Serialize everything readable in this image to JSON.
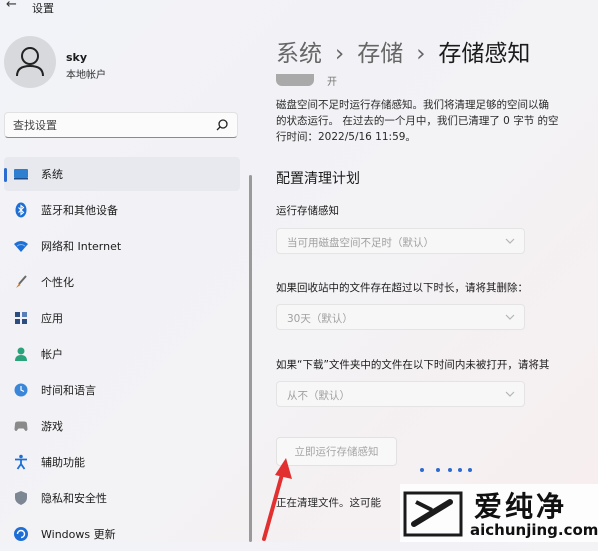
{
  "window": {
    "title": "设置",
    "back_icon": "back-arrow-icon"
  },
  "user": {
    "name": "sky",
    "account_type": "本地帐户"
  },
  "search": {
    "placeholder": "查找设置",
    "icon": "search-icon"
  },
  "sidebar": {
    "items": [
      {
        "label": "系统",
        "icon": "monitor-icon",
        "active": true
      },
      {
        "label": "蓝牙和其他设备",
        "icon": "bluetooth-icon",
        "active": false
      },
      {
        "label": "网络和 Internet",
        "icon": "wifi-icon",
        "active": false
      },
      {
        "label": "个性化",
        "icon": "brush-icon",
        "active": false
      },
      {
        "label": "应用",
        "icon": "apps-icon",
        "active": false
      },
      {
        "label": "帐户",
        "icon": "person-icon",
        "active": false
      },
      {
        "label": "时间和语言",
        "icon": "globe-clock-icon",
        "active": false
      },
      {
        "label": "游戏",
        "icon": "gamepad-icon",
        "active": false
      },
      {
        "label": "辅助功能",
        "icon": "accessibility-icon",
        "active": false
      },
      {
        "label": "隐私和安全性",
        "icon": "shield-icon",
        "active": false
      },
      {
        "label": "Windows 更新",
        "icon": "update-icon",
        "active": false
      }
    ]
  },
  "breadcrumb": {
    "items": [
      "系统",
      "存储"
    ],
    "current": "存储感知",
    "separator": "›"
  },
  "toggle": {
    "label": "开"
  },
  "description": {
    "lines": [
      "磁盘空间不足时运行存储感知。我们将清理足够的空间以确",
      "的状态运行。 在过去的一个月中，我们已清理了 0 字节 的空",
      "行时间：2022/5/16 11:59。"
    ]
  },
  "cleanup_plan": {
    "title": "配置清理计划",
    "fields": [
      {
        "label": "运行存储感知",
        "value": "当可用磁盘空间不足时（默认）"
      },
      {
        "label": "如果回收站中的文件存在超过以下时长，请将其删除：",
        "value": "30天（默认）"
      },
      {
        "label": "如果“下载”文件夹中的文件在以下时间内未被打开，请将其",
        "value": "从不（默认）"
      }
    ],
    "run_button": "立即运行存储感知",
    "status_text": "正在清理文件。这可能"
  },
  "watermark": {
    "text": "爱纯净",
    "url": "aichunjing.com"
  },
  "colors": {
    "accent": "#2c6cd0",
    "arrow": "#e23030"
  }
}
